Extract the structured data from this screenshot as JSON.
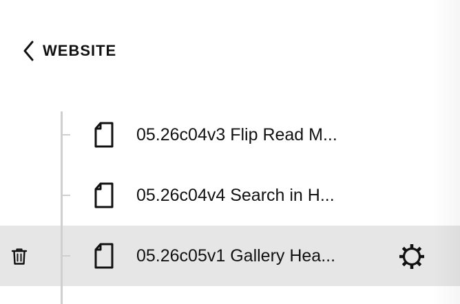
{
  "nav": {
    "back_label": "WEBSITE",
    "back_icon": "chevron-left-icon"
  },
  "pages": [
    {
      "title": "05.26c04v3 Flip Read M...",
      "icon": "page-icon",
      "selected": false
    },
    {
      "title": "05.26c04v4 Search in H...",
      "icon": "page-icon",
      "selected": false
    },
    {
      "title": "05.26c05v1 Gallery Hea...",
      "icon": "page-icon",
      "selected": true,
      "actions": [
        "trash-icon",
        "gear-icon"
      ]
    }
  ],
  "colors": {
    "selected_row_bg": "#e6e6e6",
    "tree_line": "#cfcfcf",
    "text": "#111111"
  }
}
